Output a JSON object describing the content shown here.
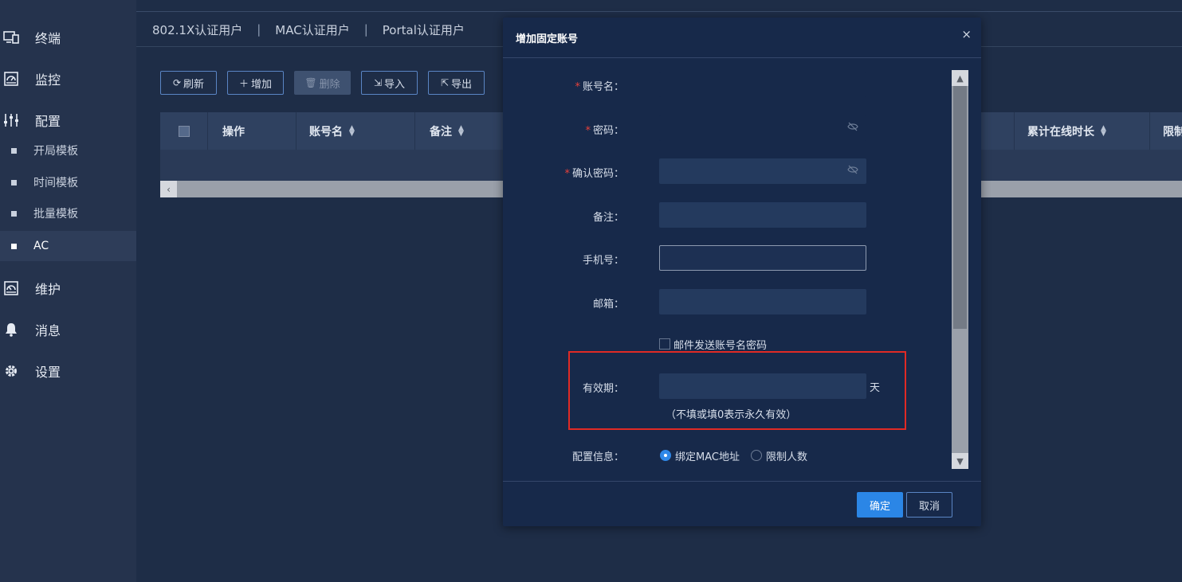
{
  "sidebar": {
    "nav": [
      {
        "label": "终端",
        "icon": "monitor-icon"
      },
      {
        "label": "监控",
        "icon": "dashboard-icon"
      },
      {
        "label": "配置",
        "icon": "sliders-icon"
      },
      {
        "label": "维护",
        "icon": "maintenance-icon"
      },
      {
        "label": "消息",
        "icon": "bell-icon"
      },
      {
        "label": "设置",
        "icon": "gear-icon"
      }
    ],
    "sub": [
      {
        "label": "开局模板"
      },
      {
        "label": "时间模板"
      },
      {
        "label": "批量模板"
      },
      {
        "label": "AC",
        "active": true
      }
    ]
  },
  "tabs": {
    "t1": "802.1X认证用户",
    "t2": "MAC认证用户",
    "t3": "Portal认证用户",
    "sep": "|"
  },
  "toolbar": {
    "refresh": "刷新",
    "add": "增加",
    "delete": "删除",
    "import": "导入",
    "export": "导出"
  },
  "table": {
    "headers": {
      "action": "操作",
      "account": "账号名",
      "remark": "备注",
      "online": "累计在线时长",
      "limit": "限制"
    }
  },
  "dialog": {
    "title": "增加固定账号",
    "close": "×",
    "fields": {
      "account": "账号名：",
      "password": "密码：",
      "confirm": "确认密码：",
      "remark": "备注：",
      "phone": "手机号：",
      "email": "邮箱：",
      "validity": "有效期：",
      "config": "配置信息："
    },
    "required_mark": "*",
    "email_send_label": "邮件发送账号名密码",
    "day_unit": "天",
    "validity_hint": "（不填或填0表示永久有效）",
    "radio_mac": "绑定MAC地址",
    "radio_limit": "限制人数",
    "ok": "确定",
    "cancel": "取消"
  },
  "colors": {
    "accent": "#2b86e6",
    "highlight": "#e02a25",
    "required": "#e8403a"
  }
}
